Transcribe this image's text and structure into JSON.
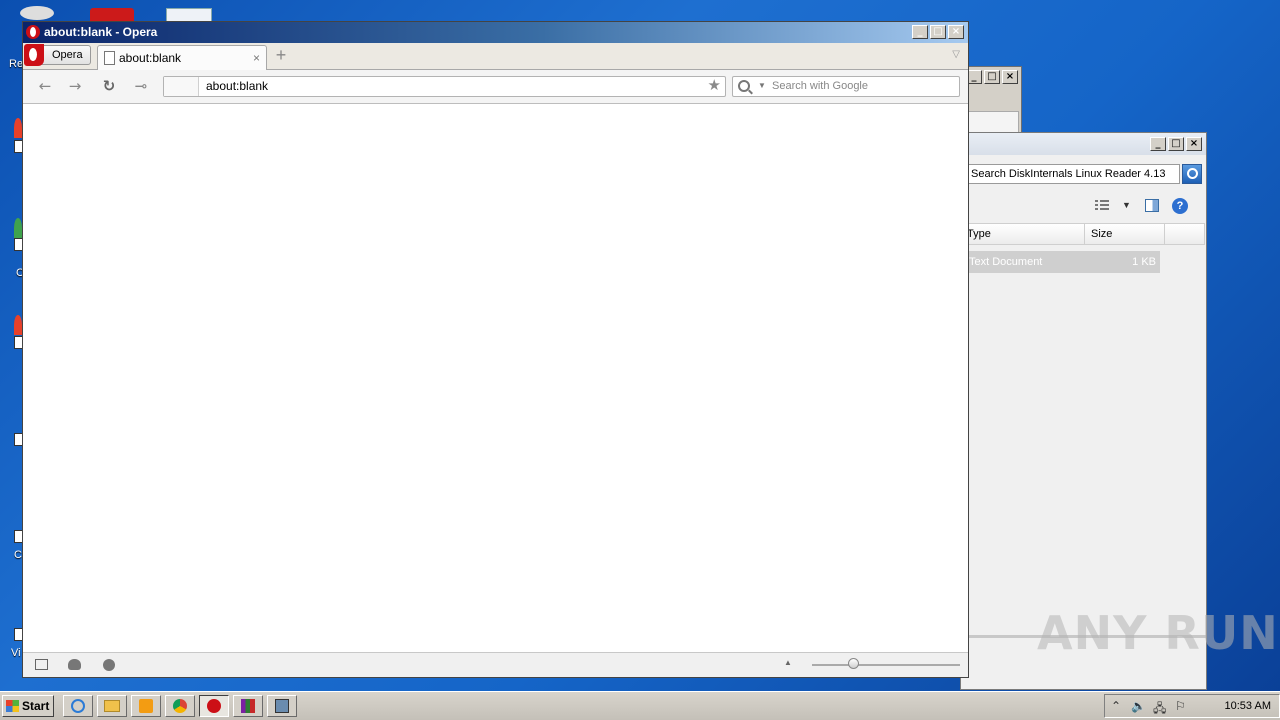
{
  "desktop": {
    "label_fragments": [
      "Re",
      "C",
      "C",
      "Vi"
    ]
  },
  "opera": {
    "window_title": "about:blank - Opera",
    "menu_button_label": "Opera",
    "tab_title": "about:blank",
    "tab_close": "×",
    "new_tab": "+",
    "address_value": "about:blank",
    "search_placeholder": "Search with Google",
    "window_buttons": {
      "minimize": "_",
      "maximize": "□",
      "close": "×"
    }
  },
  "background_window": {
    "window_buttons": {
      "minimize": "_",
      "maximize": "□",
      "close": "×"
    }
  },
  "diskinternals": {
    "search_value": "Search DiskInternals Linux Reader 4.13",
    "columns": [
      "Type",
      "Size"
    ],
    "rows": [
      {
        "type": "Text Document",
        "size": "1 KB"
      }
    ],
    "window_buttons": {
      "minimize": "_",
      "maximize": "□",
      "close": "×"
    }
  },
  "taskbar": {
    "start_label": "Start",
    "clock": "10:53 AM"
  },
  "watermark": "ANY RUN"
}
